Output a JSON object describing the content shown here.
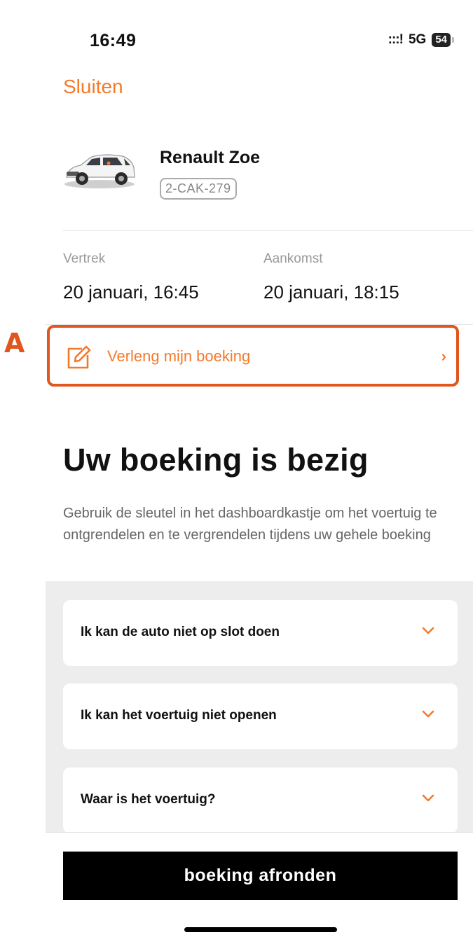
{
  "status_bar": {
    "time": "16:49",
    "signal": ":::!",
    "network": "5G",
    "battery": "54"
  },
  "close_label": "Sluiten",
  "car": {
    "name": "Renault Zoe",
    "plate": "2-CAK-279"
  },
  "trip": {
    "departure_label": "Vertrek",
    "departure_value": "20 januari, 16:45",
    "arrival_label": "Aankomst",
    "arrival_value": "20 januari, 18:15"
  },
  "extend": {
    "label": "Verleng mijn boeking",
    "chevron": "›",
    "marker": "A"
  },
  "status": {
    "heading": "Uw boeking is bezig",
    "description": "Gebruik de sleutel in het dashboardkastje om het voertuig te ontgrendelen en te vergrendelen tijdens uw gehele boeking"
  },
  "faq": [
    {
      "question": "Ik kan de auto niet op slot doen"
    },
    {
      "question": "Ik kan het voertuig niet openen"
    },
    {
      "question": "Waar is het voertuig?"
    }
  ],
  "finish_button": "boeking afronden",
  "colors": {
    "accent": "#f5792a",
    "highlight": "#e0561c",
    "button": "#000000"
  }
}
